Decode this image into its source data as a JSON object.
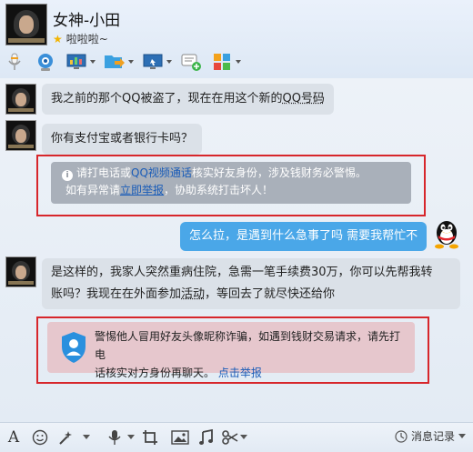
{
  "header": {
    "title": "女神-小田",
    "status": "啦啦啦~"
  },
  "toolbar": {
    "items": [
      "microphone-icon",
      "video-call-icon",
      "screen-share-icon",
      "file-transfer-icon",
      "remote-assist-icon",
      "add-contact-icon",
      "apps-icon"
    ]
  },
  "messages": [
    {
      "text_prefix": "我之前的那个QQ被盗了，现在在用这个新的",
      "link": "QQ号码"
    },
    {
      "text": "你有支付宝或者银行卡吗？"
    },
    {
      "system": {
        "line1_prefix": "请打电话或",
        "line1_link": "QQ视频通话",
        "line1_suffix": "核实好友身份，涉及钱财务必警惕。",
        "line2_prefix": "如有异常请",
        "line2_link": "立即举报",
        "line2_suffix": "，协助系统打击坏人！"
      }
    },
    {
      "text": "怎么拉，是遇到什么急事了吗 需要我帮忙不"
    },
    {
      "text_line1": "是这样的，我家人突然重病住院，急需一笔手续费30万，你可以先帮我转",
      "text_line2_prefix": "账吗？我现在在外面参加",
      "text_line2_link": "活动",
      "text_line2_suffix": "，等回去了就尽快还给你"
    },
    {
      "warning": {
        "line1": "警惕他人冒用好友头像昵称诈骗，如遇到钱财交易请求，请先打电",
        "line2_prefix": "话核实对方身份再聊天。",
        "line2_link": "点击举报"
      }
    }
  ],
  "bottom_toolbar": {
    "items": [
      "font-icon",
      "emoji-icon",
      "magic-icon",
      "voice-message-icon",
      "screenshot-icon",
      "image-icon",
      "music-icon",
      "scissors-icon"
    ],
    "history_label": "消息记录"
  },
  "colors": {
    "accent_bubble": "#4aa7e8",
    "link": "#1a5cb8",
    "highlight_border": "#d7262b"
  }
}
